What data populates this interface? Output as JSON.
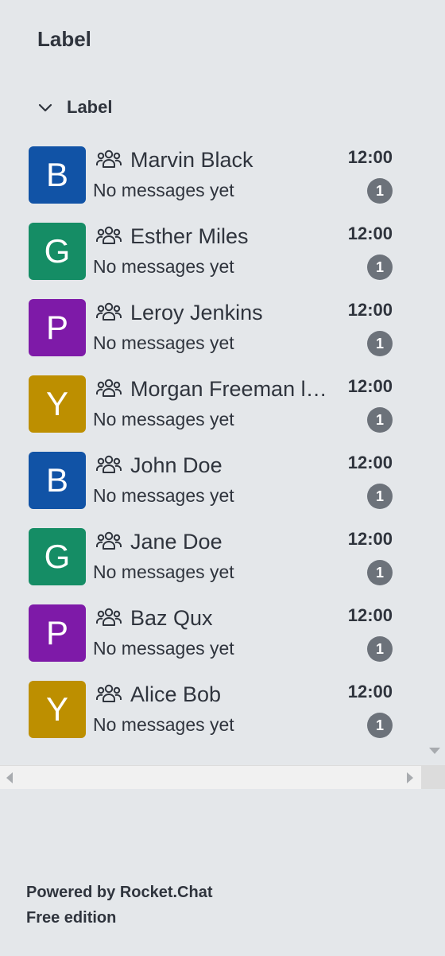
{
  "sidebar": {
    "title": "Label",
    "group": {
      "label": "Label",
      "chevron_icon": "chevron-down-icon"
    },
    "colors": {
      "blue": "#1153a6",
      "green": "#158d65",
      "purple": "#7e1aa8",
      "yellow": "#bd8f00",
      "badge": "#6c727a"
    },
    "rooms": [
      {
        "initial": "B",
        "color": "#1153a6",
        "name": "Marvin Black",
        "preview": "No messages yet",
        "time": "12:00",
        "unread": "1",
        "icon": "team-icon"
      },
      {
        "initial": "G",
        "color": "#158d65",
        "name": "Esther Miles",
        "preview": "No messages yet",
        "time": "12:00",
        "unread": "1",
        "icon": "team-icon"
      },
      {
        "initial": "P",
        "color": "#7e1aa8",
        "name": "Leroy Jenkins",
        "preview": "No messages yet",
        "time": "12:00",
        "unread": "1",
        "icon": "team-icon"
      },
      {
        "initial": "Y",
        "color": "#bd8f00",
        "name": "Morgan Freeman long name",
        "preview": "No messages yet",
        "time": "12:00",
        "unread": "1",
        "icon": "team-icon"
      },
      {
        "initial": "B",
        "color": "#1153a6",
        "name": "John Doe",
        "preview": "No messages yet",
        "time": "12:00",
        "unread": "1",
        "icon": "team-icon"
      },
      {
        "initial": "G",
        "color": "#158d65",
        "name": "Jane Doe",
        "preview": "No messages yet",
        "time": "12:00",
        "unread": "1",
        "icon": "team-icon"
      },
      {
        "initial": "P",
        "color": "#7e1aa8",
        "name": "Baz Qux",
        "preview": "No messages yet",
        "time": "12:00",
        "unread": "1",
        "icon": "team-icon"
      },
      {
        "initial": "Y",
        "color": "#bd8f00",
        "name": "Alice Bob",
        "preview": "No messages yet",
        "time": "12:00",
        "unread": "1",
        "icon": "team-icon"
      }
    ]
  },
  "footer": {
    "powered_by": "Powered by Rocket.Chat",
    "edition": "Free edition"
  }
}
